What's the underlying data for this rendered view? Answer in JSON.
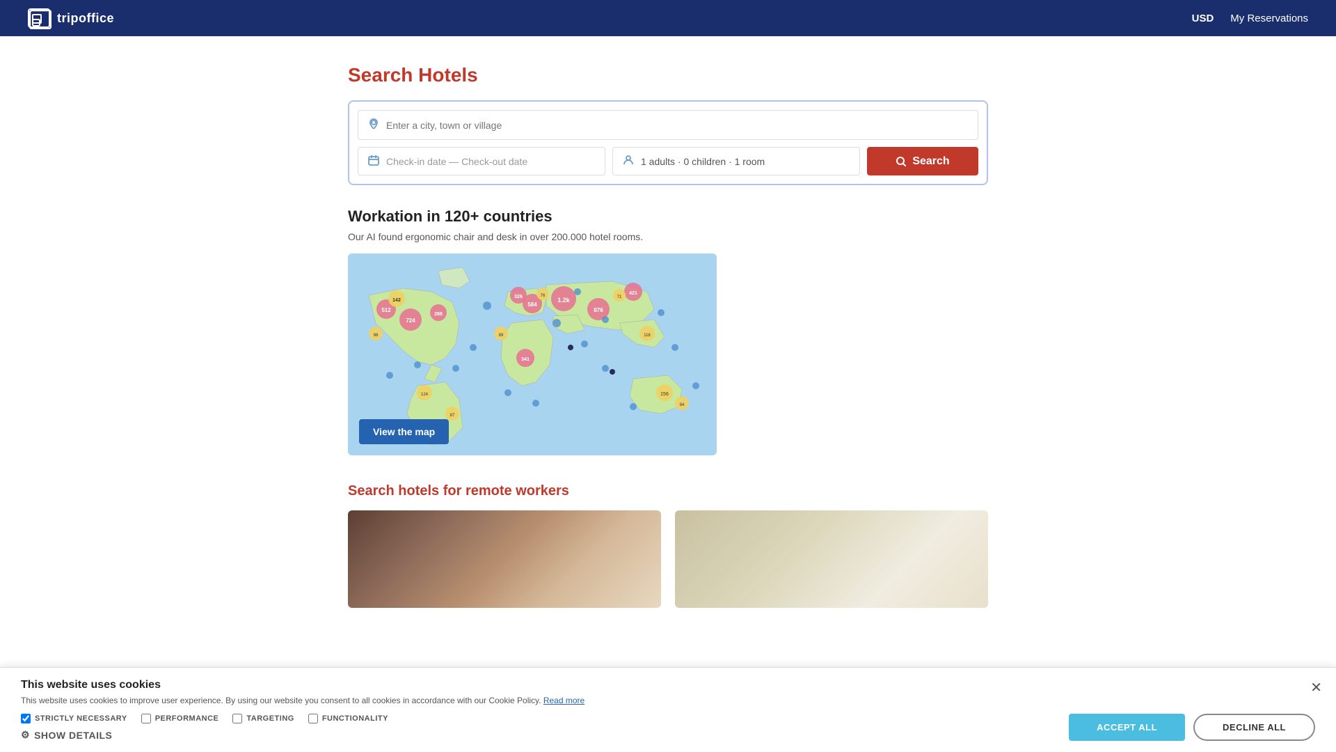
{
  "header": {
    "logo_text": "tripoffice",
    "currency": "USD",
    "reservations": "My Reservations"
  },
  "search": {
    "title_plain": "Search ",
    "title_highlight": "Hotels",
    "location_placeholder": "Enter a city, town or village",
    "dates_placeholder": "Check-in date — Check-out date",
    "guests_value": "1 adults · 0 children · 1 room",
    "search_button": "Search"
  },
  "workation": {
    "title": "Workation in 120+ countries",
    "subtitle": "Our AI found ergonomic chair and desk in over 200.000 hotel rooms.",
    "view_map_button": "View the map"
  },
  "workers_section": {
    "title_plain": "Search hotels for ",
    "title_highlight": "remote workers"
  },
  "cookies": {
    "title": "This website uses cookies",
    "description": "This website uses cookies to improve user experience. By using our website you consent to all cookies in accordance with our Cookie Policy.",
    "read_more": "Read more",
    "strictly_necessary": "STRICTLY NECESSARY",
    "performance": "PERFORMANCE",
    "targeting": "TARGETING",
    "functionality": "FUNCTIONALITY",
    "show_details": "SHOW DETAILS",
    "accept_all": "ACCEPT ALL",
    "decline_all": "DECLINE ALL"
  }
}
